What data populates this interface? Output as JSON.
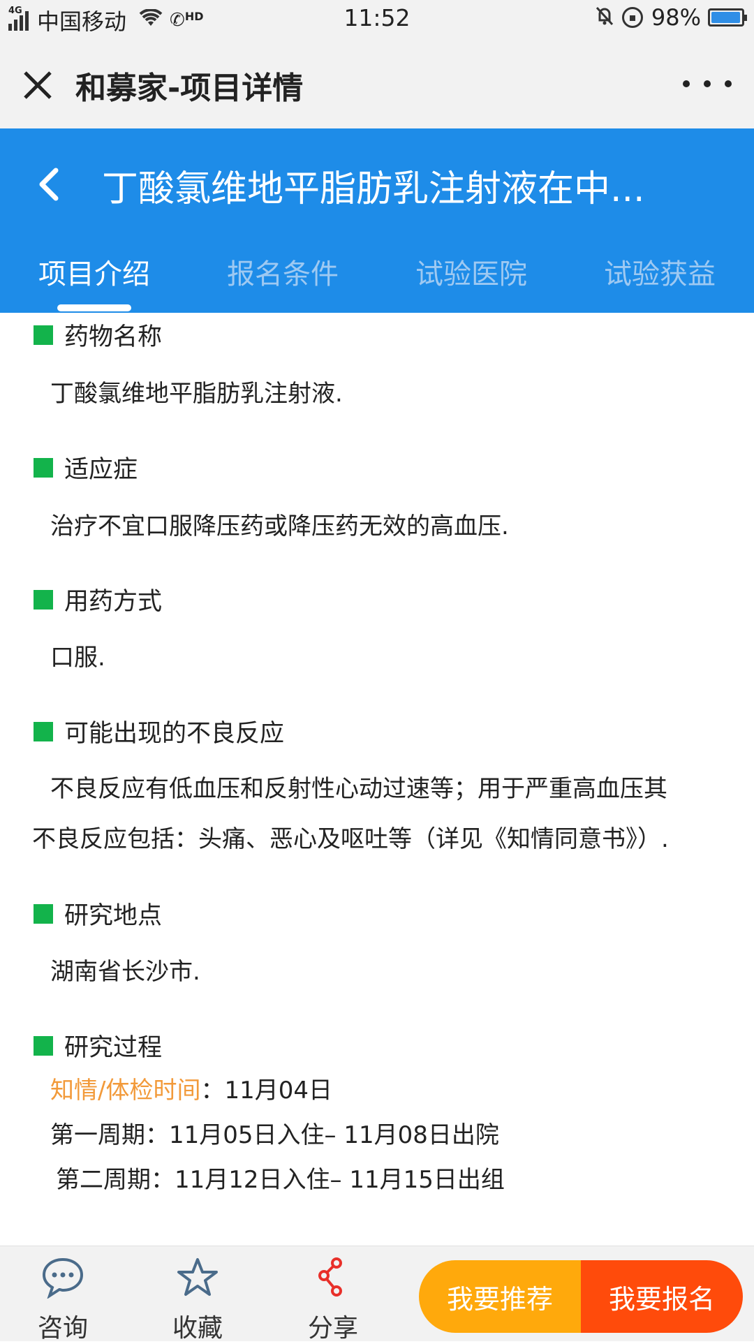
{
  "status_bar": {
    "network": "4G",
    "carrier": "中国移动",
    "hd": "HD",
    "time": "11:52",
    "battery": "98%",
    "battery_level": 0.98
  },
  "app_header": {
    "title": "和募家-项目详情"
  },
  "page": {
    "title": "丁酸氯维地平脂肪乳注射液在中...",
    "accent_color": "#1e8ce8"
  },
  "tabs": [
    {
      "label": "项目介绍",
      "active": true
    },
    {
      "label": "报名条件",
      "active": false
    },
    {
      "label": "试验医院",
      "active": false
    },
    {
      "label": "试验获益",
      "active": false
    }
  ],
  "sections": {
    "drug_name": {
      "heading": "药物名称",
      "text": "丁酸氯维地平脂肪乳注射液."
    },
    "indication": {
      "heading": "适应症",
      "text": "治疗不宜口服降压药或降压药无效的高血压."
    },
    "administration": {
      "heading": "用药方式",
      "text": "口服."
    },
    "adverse": {
      "heading": "可能出现的不良反应",
      "text_line1": "不良反应有低血压和反射性心动过速等；用于严重高血压其",
      "text_line2": "不良反应包括：头痛、恶心及呕吐等（详见《知情同意书》）."
    },
    "location": {
      "heading": "研究地点",
      "text": "湖南省长沙市."
    },
    "process": {
      "heading": "研究过程",
      "consent_label": "知情/体检时间",
      "consent_value": "：11月04日",
      "period1": "第一周期：11月05日入住– 11月08日出院",
      "period2": "第二周期：11月12日入住– 11月15日出组"
    }
  },
  "bottom_bar": {
    "consult": "咨询",
    "favorite": "收藏",
    "share": "分享",
    "recommend_button": "我要推荐",
    "signup_button": "我要报名"
  }
}
